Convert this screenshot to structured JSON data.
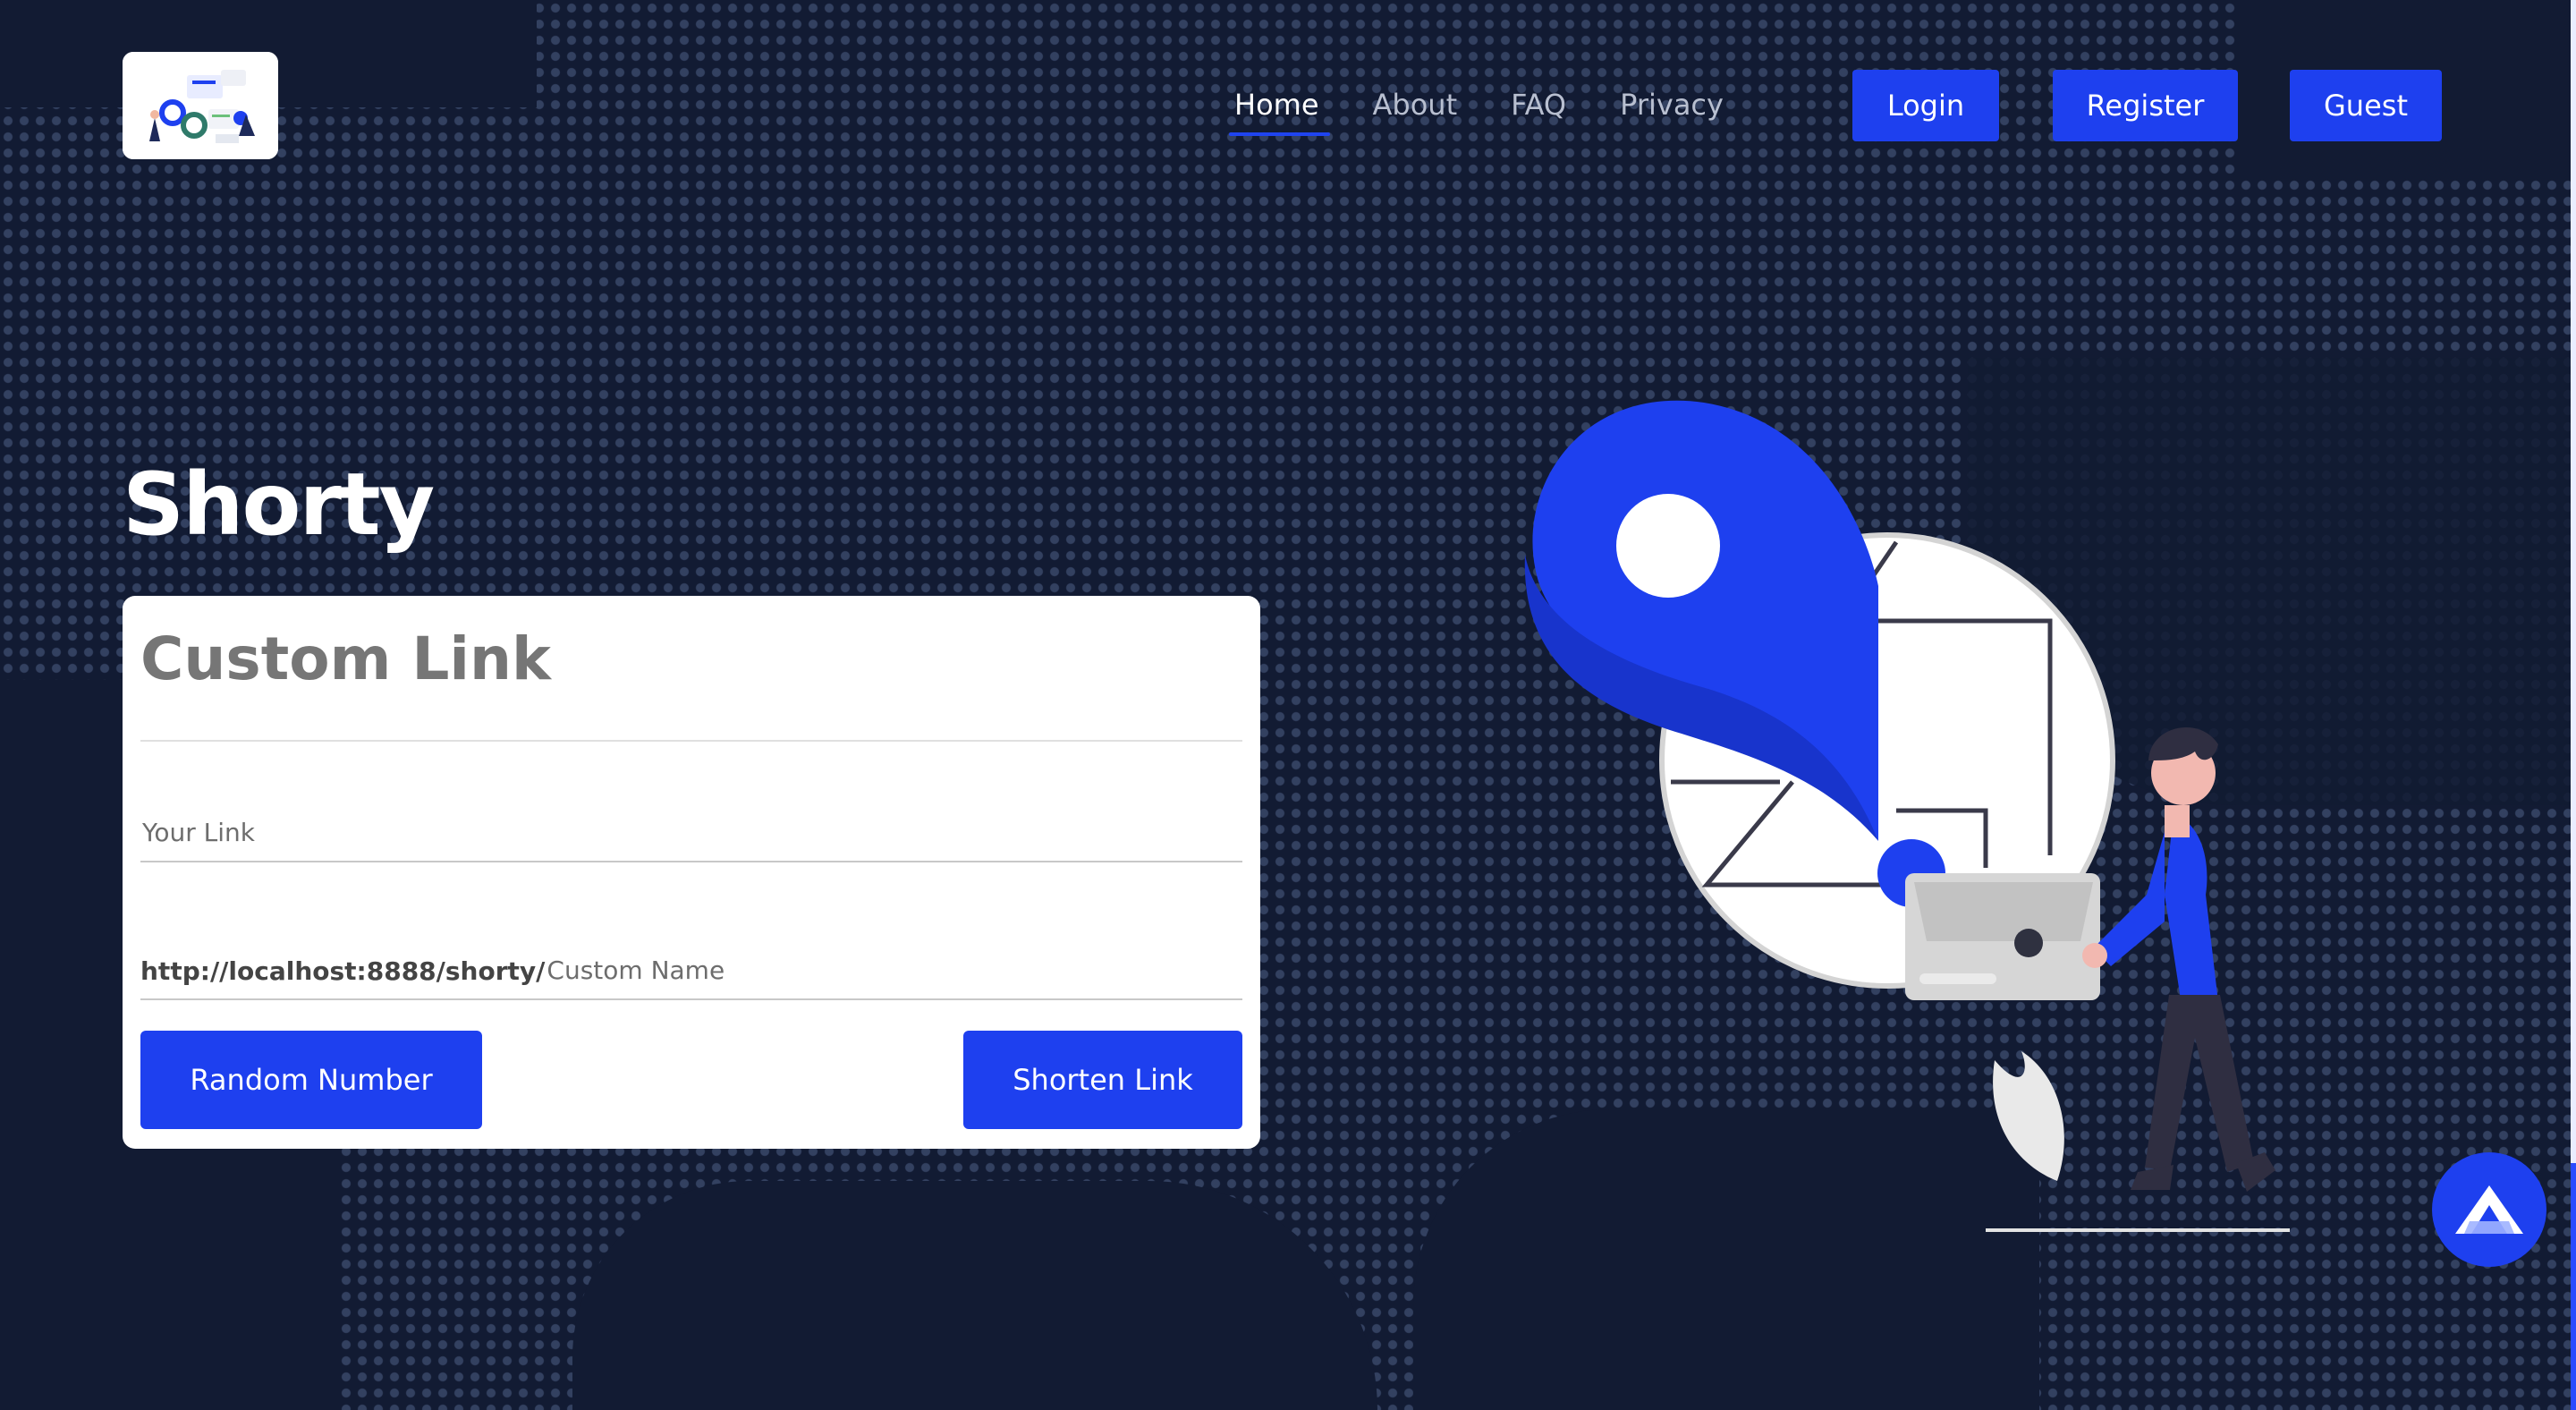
{
  "nav": {
    "links": [
      "Home",
      "About",
      "FAQ",
      "Privacy"
    ],
    "active": "Home",
    "buttons": {
      "login": "Login",
      "register": "Register",
      "guest": "Guest"
    }
  },
  "hero": {
    "title": "Shorty"
  },
  "card": {
    "title": "Custom Link",
    "link_placeholder": "Your Link",
    "link_value": "",
    "url_prefix": "http://localhost:8888/shorty/",
    "custom_placeholder": "Custom Name",
    "custom_value": "",
    "random_button": "Random Number",
    "shorten_button": "Shorten Link"
  },
  "icons": {
    "logo": "logo-illustration-icon",
    "fab": "assistant-logo-icon",
    "illustration": "location-pin-illustration"
  },
  "colors": {
    "background": "#121b33",
    "accent": "#1e40ef",
    "card": "#ffffff",
    "title_gray": "#767676"
  }
}
